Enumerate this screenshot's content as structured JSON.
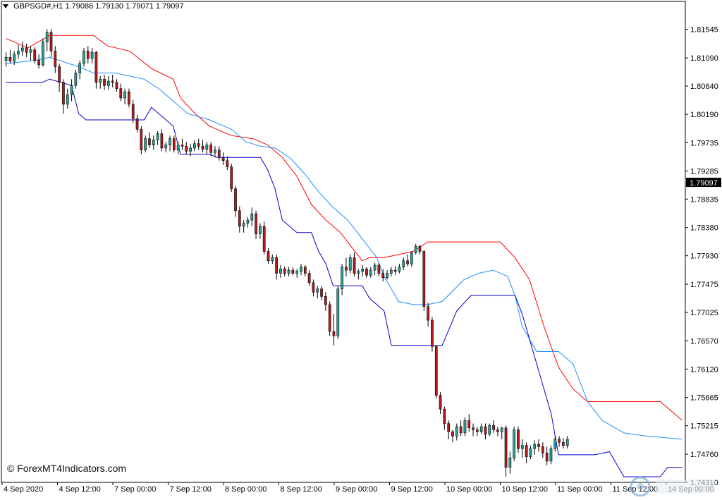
{
  "header": {
    "symbol": "GBPSGD#,H1",
    "ohlc": "1.79086 1.79130 1.79071 1.79097"
  },
  "watermark": "© ForexMT4Indicators.com",
  "colors": {
    "bull": "#26a69a",
    "bear": "#b71c1c",
    "upper_band": "#ff0000",
    "middle_line": "#1e90ff",
    "lower_band": "#0000cd",
    "current_price_bg": "#000000",
    "current_price_text": "#ffffff"
  },
  "chart_data": {
    "type": "candlestick",
    "title": "",
    "symbol": "GBPSGD#",
    "timeframe": "H1",
    "ylim": [
      1.7431,
      1.8179
    ],
    "y_ticks": [
      "1.81545",
      "1.81090",
      "1.80640",
      "1.80190",
      "1.79735",
      "1.79285",
      "1.78835",
      "1.78380",
      "1.77930",
      "1.77475",
      "1.77025",
      "1.76570",
      "1.76120",
      "1.75665",
      "1.75215",
      "1.74760",
      "1.74310"
    ],
    "current_price": "1.79097",
    "x_ticks": [
      "4 Sep 2020",
      "4 Sep 12:00",
      "7 Sep 00:00",
      "7 Sep 12:00",
      "8 Sep 00:00",
      "8 Sep 12:00",
      "9 Sep 00:00",
      "9 Sep 12:00",
      "10 Sep 00:00",
      "10 Sep 12:00",
      "11 Sep 00:00",
      "11 Sep 12:00",
      "14 Sep 00:00"
    ],
    "x_tick_index": [
      0,
      12,
      24,
      36,
      48,
      60,
      72,
      84,
      96,
      108,
      120,
      132,
      144
    ],
    "candles": [
      [
        1.8105,
        1.8118,
        1.8095,
        1.811
      ],
      [
        1.811,
        1.8122,
        1.81,
        1.8104
      ],
      [
        1.8104,
        1.812,
        1.8098,
        1.8115
      ],
      [
        1.8115,
        1.813,
        1.8108,
        1.812
      ],
      [
        1.812,
        1.8135,
        1.8112,
        1.8125
      ],
      [
        1.8125,
        1.8132,
        1.811,
        1.8118
      ],
      [
        1.8118,
        1.8128,
        1.8105,
        1.8122
      ],
      [
        1.8122,
        1.8126,
        1.81,
        1.8105
      ],
      [
        1.8105,
        1.8115,
        1.8092,
        1.8098
      ],
      [
        1.8098,
        1.814,
        1.8095,
        1.8135
      ],
      [
        1.8135,
        1.8155,
        1.812,
        1.815
      ],
      [
        1.815,
        1.8155,
        1.811,
        1.812
      ],
      [
        1.812,
        1.8128,
        1.8085,
        1.8095
      ],
      [
        1.8095,
        1.81,
        1.8055,
        1.807
      ],
      [
        1.807,
        1.8075,
        1.802,
        1.8035
      ],
      [
        1.8035,
        1.806,
        1.8028,
        1.805
      ],
      [
        1.805,
        1.8075,
        1.804,
        1.8065
      ],
      [
        1.8065,
        1.809,
        1.806,
        1.8085
      ],
      [
        1.8085,
        1.8105,
        1.8075,
        1.81
      ],
      [
        1.81,
        1.8125,
        1.8095,
        1.812
      ],
      [
        1.812,
        1.8128,
        1.81,
        1.8108
      ],
      [
        1.8108,
        1.8125,
        1.81,
        1.8118
      ],
      [
        1.8118,
        1.812,
        1.806,
        1.807
      ],
      [
        1.807,
        1.808,
        1.806,
        1.8075
      ],
      [
        1.8075,
        1.8082,
        1.8058,
        1.8065
      ],
      [
        1.8065,
        1.808,
        1.8058,
        1.8072
      ],
      [
        1.8072,
        1.8082,
        1.8062,
        1.807
      ],
      [
        1.807,
        1.8075,
        1.8055,
        1.806
      ],
      [
        1.806,
        1.8068,
        1.804,
        1.8045
      ],
      [
        1.8045,
        1.806,
        1.8035,
        1.8055
      ],
      [
        1.8055,
        1.806,
        1.803,
        1.8035
      ],
      [
        1.8035,
        1.8042,
        1.8005,
        1.8012
      ],
      [
        1.8012,
        1.8018,
        1.799,
        1.7995
      ],
      [
        1.7995,
        1.8,
        1.7955,
        1.7962
      ],
      [
        1.7962,
        1.7985,
        1.7958,
        1.798
      ],
      [
        1.798,
        1.799,
        1.7965,
        1.797
      ],
      [
        1.797,
        1.7985,
        1.7962,
        1.7978
      ],
      [
        1.7978,
        1.7992,
        1.797,
        1.7988
      ],
      [
        1.7988,
        1.7995,
        1.796,
        1.7965
      ],
      [
        1.7965,
        1.7975,
        1.7958,
        1.797
      ],
      [
        1.797,
        1.7985,
        1.796,
        1.798
      ],
      [
        1.798,
        1.7985,
        1.7958,
        1.7962
      ],
      [
        1.7962,
        1.7975,
        1.7955,
        1.797
      ],
      [
        1.797,
        1.798,
        1.7962,
        1.7968
      ],
      [
        1.7968,
        1.7975,
        1.7955,
        1.796
      ],
      [
        1.796,
        1.7972,
        1.7952,
        1.7965
      ],
      [
        1.7965,
        1.7978,
        1.796,
        1.7972
      ],
      [
        1.7972,
        1.798,
        1.7962,
        1.7968
      ],
      [
        1.7968,
        1.7978,
        1.7958,
        1.7963
      ],
      [
        1.7963,
        1.7975,
        1.7955,
        1.797
      ],
      [
        1.797,
        1.7975,
        1.7952,
        1.7958
      ],
      [
        1.7958,
        1.7968,
        1.795,
        1.7962
      ],
      [
        1.7962,
        1.7968,
        1.7945,
        1.795
      ],
      [
        1.795,
        1.7958,
        1.7938,
        1.7945
      ],
      [
        1.7945,
        1.7952,
        1.793,
        1.7935
      ],
      [
        1.7935,
        1.794,
        1.7895,
        1.79
      ],
      [
        1.79,
        1.7905,
        1.7855,
        1.7865
      ],
      [
        1.7865,
        1.7872,
        1.783,
        1.784
      ],
      [
        1.784,
        1.785,
        1.783,
        1.7845
      ],
      [
        1.7845,
        1.7855,
        1.7838,
        1.785
      ],
      [
        1.785,
        1.787,
        1.784,
        1.786
      ],
      [
        1.786,
        1.7865,
        1.782,
        1.7828
      ],
      [
        1.7828,
        1.7845,
        1.782,
        1.784
      ],
      [
        1.784,
        1.7848,
        1.7795,
        1.78
      ],
      [
        1.78,
        1.7805,
        1.778,
        1.7785
      ],
      [
        1.7785,
        1.7795,
        1.778,
        1.779
      ],
      [
        1.779,
        1.7795,
        1.7755,
        1.7765
      ],
      [
        1.7765,
        1.7778,
        1.7758,
        1.7772
      ],
      [
        1.7772,
        1.7776,
        1.776,
        1.7765
      ],
      [
        1.7765,
        1.7775,
        1.776,
        1.777
      ],
      [
        1.777,
        1.7775,
        1.7762,
        1.7765
      ],
      [
        1.7765,
        1.7772,
        1.7758,
        1.7768
      ],
      [
        1.7768,
        1.778,
        1.7762,
        1.7775
      ],
      [
        1.7775,
        1.7778,
        1.776,
        1.7765
      ],
      [
        1.7765,
        1.777,
        1.7745,
        1.775
      ],
      [
        1.775,
        1.7755,
        1.7728,
        1.7735
      ],
      [
        1.7735,
        1.7745,
        1.7725,
        1.774
      ],
      [
        1.774,
        1.7745,
        1.7722,
        1.7728
      ],
      [
        1.7728,
        1.7735,
        1.7705,
        1.7715
      ],
      [
        1.7715,
        1.772,
        1.7665,
        1.7672
      ],
      [
        1.7672,
        1.77,
        1.765,
        1.7665
      ],
      [
        1.7665,
        1.7745,
        1.766,
        1.774
      ],
      [
        1.774,
        1.778,
        1.773,
        1.7775
      ],
      [
        1.7775,
        1.779,
        1.776,
        1.777
      ],
      [
        1.777,
        1.7795,
        1.7765,
        1.779
      ],
      [
        1.779,
        1.7798,
        1.776,
        1.7765
      ],
      [
        1.7765,
        1.7772,
        1.7755,
        1.7768
      ],
      [
        1.7768,
        1.7778,
        1.776,
        1.7772
      ],
      [
        1.7772,
        1.7775,
        1.7758,
        1.7762
      ],
      [
        1.7762,
        1.7775,
        1.7758,
        1.777
      ],
      [
        1.777,
        1.7782,
        1.7762,
        1.7778
      ],
      [
        1.7778,
        1.7782,
        1.776,
        1.7765
      ],
      [
        1.7765,
        1.7772,
        1.7752,
        1.7758
      ],
      [
        1.7758,
        1.777,
        1.7755,
        1.7765
      ],
      [
        1.7765,
        1.7775,
        1.776,
        1.777
      ],
      [
        1.777,
        1.7776,
        1.7762,
        1.7768
      ],
      [
        1.7768,
        1.778,
        1.7765,
        1.7775
      ],
      [
        1.7775,
        1.779,
        1.777,
        1.7785
      ],
      [
        1.7785,
        1.7795,
        1.7776,
        1.778
      ],
      [
        1.778,
        1.78,
        1.7775,
        1.7798
      ],
      [
        1.7798,
        1.7812,
        1.7795,
        1.7808
      ],
      [
        1.7808,
        1.781,
        1.7795,
        1.78
      ],
      [
        1.78,
        1.7802,
        1.7705,
        1.7712
      ],
      [
        1.7712,
        1.7718,
        1.768,
        1.769
      ],
      [
        1.769,
        1.7695,
        1.764,
        1.7648
      ],
      [
        1.7648,
        1.765,
        1.7565,
        1.757
      ],
      [
        1.757,
        1.7575,
        1.754,
        1.7548
      ],
      [
        1.7548,
        1.7552,
        1.7515,
        1.7525
      ],
      [
        1.7525,
        1.753,
        1.75,
        1.7512
      ],
      [
        1.7512,
        1.7515,
        1.7495,
        1.7505
      ],
      [
        1.7505,
        1.7525,
        1.7498,
        1.752
      ],
      [
        1.752,
        1.753,
        1.7505,
        1.751
      ],
      [
        1.751,
        1.7535,
        1.7505,
        1.753
      ],
      [
        1.753,
        1.754,
        1.7512,
        1.7518
      ],
      [
        1.7518,
        1.7525,
        1.7505,
        1.7515
      ],
      [
        1.7515,
        1.752,
        1.7505,
        1.7512
      ],
      [
        1.7512,
        1.7525,
        1.7508,
        1.752
      ],
      [
        1.752,
        1.7525,
        1.75,
        1.7508
      ],
      [
        1.7508,
        1.7525,
        1.7505,
        1.7522
      ],
      [
        1.7522,
        1.753,
        1.751,
        1.7515
      ],
      [
        1.7515,
        1.752,
        1.7505,
        1.7512
      ],
      [
        1.7512,
        1.752,
        1.75,
        1.7518
      ],
      [
        1.7518,
        1.7522,
        1.744,
        1.7455
      ],
      [
        1.7455,
        1.748,
        1.7445,
        1.747
      ],
      [
        1.747,
        1.752,
        1.7465,
        1.7515
      ],
      [
        1.7515,
        1.752,
        1.7478,
        1.7485
      ],
      [
        1.7485,
        1.75,
        1.747,
        1.749
      ],
      [
        1.749,
        1.7495,
        1.7462,
        1.7472
      ],
      [
        1.7472,
        1.749,
        1.7468,
        1.7485
      ],
      [
        1.7485,
        1.7498,
        1.7475,
        1.7492
      ],
      [
        1.7492,
        1.75,
        1.748,
        1.7488
      ],
      [
        1.7488,
        1.7495,
        1.747,
        1.7478
      ],
      [
        1.7478,
        1.7488,
        1.7458,
        1.7465
      ],
      [
        1.7465,
        1.749,
        1.746,
        1.7485
      ],
      [
        1.7485,
        1.7505,
        1.748,
        1.75
      ],
      [
        1.75,
        1.7505,
        1.7488,
        1.7495
      ],
      [
        1.7495,
        1.7502,
        1.7485,
        1.749
      ],
      [
        1.749,
        1.7505,
        1.7485,
        1.75
      ]
    ],
    "series": [
      {
        "name": "",
        "color": "#ff0000",
        "points": [
          [
            0,
            1.814
          ],
          [
            6,
            1.8125
          ],
          [
            12,
            1.8145
          ],
          [
            24,
            1.8145
          ],
          [
            28,
            1.8128
          ],
          [
            34,
            1.812
          ],
          [
            40,
            1.8092
          ],
          [
            46,
            1.8075
          ],
          [
            48,
            1.8045
          ],
          [
            52,
            1.802
          ],
          [
            56,
            1.8
          ],
          [
            62,
            1.7985
          ],
          [
            68,
            1.798
          ],
          [
            72,
            1.797
          ],
          [
            76,
            1.795
          ],
          [
            80,
            1.792
          ],
          [
            84,
            1.7875
          ],
          [
            88,
            1.785
          ],
          [
            92,
            1.783
          ],
          [
            96,
            1.78
          ],
          [
            98,
            1.7785
          ],
          [
            100,
            1.779
          ],
          [
            104,
            1.779
          ],
          [
            108,
            1.7795
          ],
          [
            112,
            1.78
          ],
          [
            116,
            1.7815
          ],
          [
            136,
            1.7815
          ],
          [
            140,
            1.779
          ],
          [
            144,
            1.7755
          ],
          [
            148,
            1.768
          ],
          [
            152,
            1.7615
          ],
          [
            156,
            1.758
          ],
          [
            160,
            1.756
          ],
          [
            180,
            1.756
          ],
          [
            186,
            1.753
          ]
        ]
      },
      {
        "name": "",
        "color": "#1e90ff",
        "points": [
          [
            0,
            1.81
          ],
          [
            8,
            1.8105
          ],
          [
            12,
            1.811
          ],
          [
            20,
            1.8095
          ],
          [
            24,
            1.8085
          ],
          [
            30,
            1.8085
          ],
          [
            34,
            1.808
          ],
          [
            38,
            1.8075
          ],
          [
            42,
            1.806
          ],
          [
            46,
            1.804
          ],
          [
            50,
            1.802
          ],
          [
            56,
            1.801
          ],
          [
            62,
            1.7995
          ],
          [
            66,
            1.7975
          ],
          [
            70,
            1.7968
          ],
          [
            74,
            1.7965
          ],
          [
            78,
            1.795
          ],
          [
            82,
            1.7925
          ],
          [
            86,
            1.7895
          ],
          [
            90,
            1.787
          ],
          [
            94,
            1.785
          ],
          [
            98,
            1.782
          ],
          [
            102,
            1.779
          ],
          [
            104,
            1.776
          ],
          [
            106,
            1.774
          ],
          [
            108,
            1.772
          ],
          [
            112,
            1.7715
          ],
          [
            116,
            1.7715
          ],
          [
            120,
            1.772
          ],
          [
            126,
            1.7755
          ],
          [
            130,
            1.7765
          ],
          [
            134,
            1.777
          ],
          [
            138,
            1.776
          ],
          [
            140,
            1.773
          ],
          [
            142,
            1.768
          ],
          [
            146,
            1.764
          ],
          [
            152,
            1.764
          ],
          [
            156,
            1.762
          ],
          [
            160,
            1.756
          ],
          [
            164,
            1.753
          ],
          [
            170,
            1.751
          ],
          [
            176,
            1.7505
          ],
          [
            186,
            1.75
          ]
        ]
      },
      {
        "name": "",
        "color": "#0000cd",
        "points": [
          [
            0,
            1.807
          ],
          [
            10,
            1.807
          ],
          [
            12,
            1.8075
          ],
          [
            18,
            1.8065
          ],
          [
            20,
            1.802
          ],
          [
            22,
            1.801
          ],
          [
            38,
            1.801
          ],
          [
            40,
            1.803
          ],
          [
            46,
            1.8
          ],
          [
            48,
            1.7955
          ],
          [
            56,
            1.7955
          ],
          [
            58,
            1.795
          ],
          [
            70,
            1.795
          ],
          [
            72,
            1.793
          ],
          [
            74,
            1.79
          ],
          [
            76,
            1.785
          ],
          [
            80,
            1.783
          ],
          [
            84,
            1.783
          ],
          [
            86,
            1.78
          ],
          [
            88,
            1.778
          ],
          [
            90,
            1.7745
          ],
          [
            98,
            1.7745
          ],
          [
            100,
            1.7725
          ],
          [
            104,
            1.7705
          ],
          [
            106,
            1.765
          ],
          [
            120,
            1.765
          ],
          [
            124,
            1.7705
          ],
          [
            128,
            1.773
          ],
          [
            140,
            1.773
          ],
          [
            142,
            1.77
          ],
          [
            146,
            1.762
          ],
          [
            150,
            1.754
          ],
          [
            152,
            1.7475
          ],
          [
            162,
            1.7475
          ],
          [
            166,
            1.748
          ],
          [
            168,
            1.746
          ],
          [
            170,
            1.744
          ],
          [
            180,
            1.744
          ],
          [
            182,
            1.7455
          ],
          [
            186,
            1.7455
          ]
        ]
      }
    ],
    "grid": false,
    "legend": "none"
  }
}
